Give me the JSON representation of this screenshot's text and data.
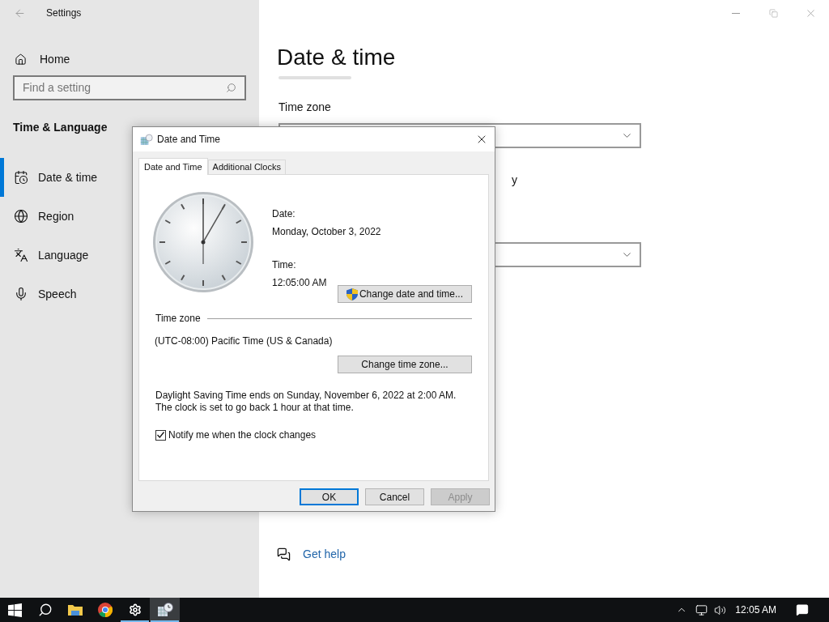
{
  "window": {
    "title": "Settings"
  },
  "sidebar": {
    "home": "Home",
    "search": {
      "placeholder": "Find a setting"
    },
    "section": "Time & Language",
    "items": [
      {
        "label": "Date & time",
        "selected": true
      },
      {
        "label": "Region",
        "selected": false
      },
      {
        "label": "Language",
        "selected": false
      },
      {
        "label": "Speech",
        "selected": false
      }
    ]
  },
  "main": {
    "title": "Date & time",
    "time_zone_label": "Time zone",
    "fragment": "y",
    "help_link": "Get help"
  },
  "dialog": {
    "title": "Date and Time",
    "tabs": [
      {
        "label": "Date and Time",
        "selected": true
      },
      {
        "label": "Additional Clocks",
        "selected": false
      }
    ],
    "date_label": "Date:",
    "date": "Monday, October 3, 2022",
    "time_label": "Time:",
    "time": "12:05:00 AM",
    "change_datetime": "Change date and time...",
    "time_zone_heading": "Time zone",
    "time_zone": "(UTC-08:00) Pacific Time (US & Canada)",
    "change_zone": "Change time zone...",
    "dst_note": "Daylight Saving Time ends on Sunday, November 6, 2022 at 2:00 AM. The clock is set to go back 1 hour at that time.",
    "notify": {
      "label": "Notify me when the clock changes",
      "checked": true
    },
    "buttons": [
      {
        "label": "OK",
        "kind": "default",
        "disabled": false
      },
      {
        "label": "Cancel",
        "kind": "normal",
        "disabled": false
      },
      {
        "label": "Apply",
        "kind": "normal",
        "disabled": true
      }
    ]
  },
  "taskbar": {
    "items": [
      {
        "running": false,
        "selected": false
      },
      {
        "running": false,
        "selected": false
      },
      {
        "running": false,
        "selected": false
      },
      {
        "running": false,
        "selected": false
      },
      {
        "running": true,
        "selected": false
      },
      {
        "running": true,
        "selected": true
      }
    ],
    "clock": "12:05 AM"
  }
}
